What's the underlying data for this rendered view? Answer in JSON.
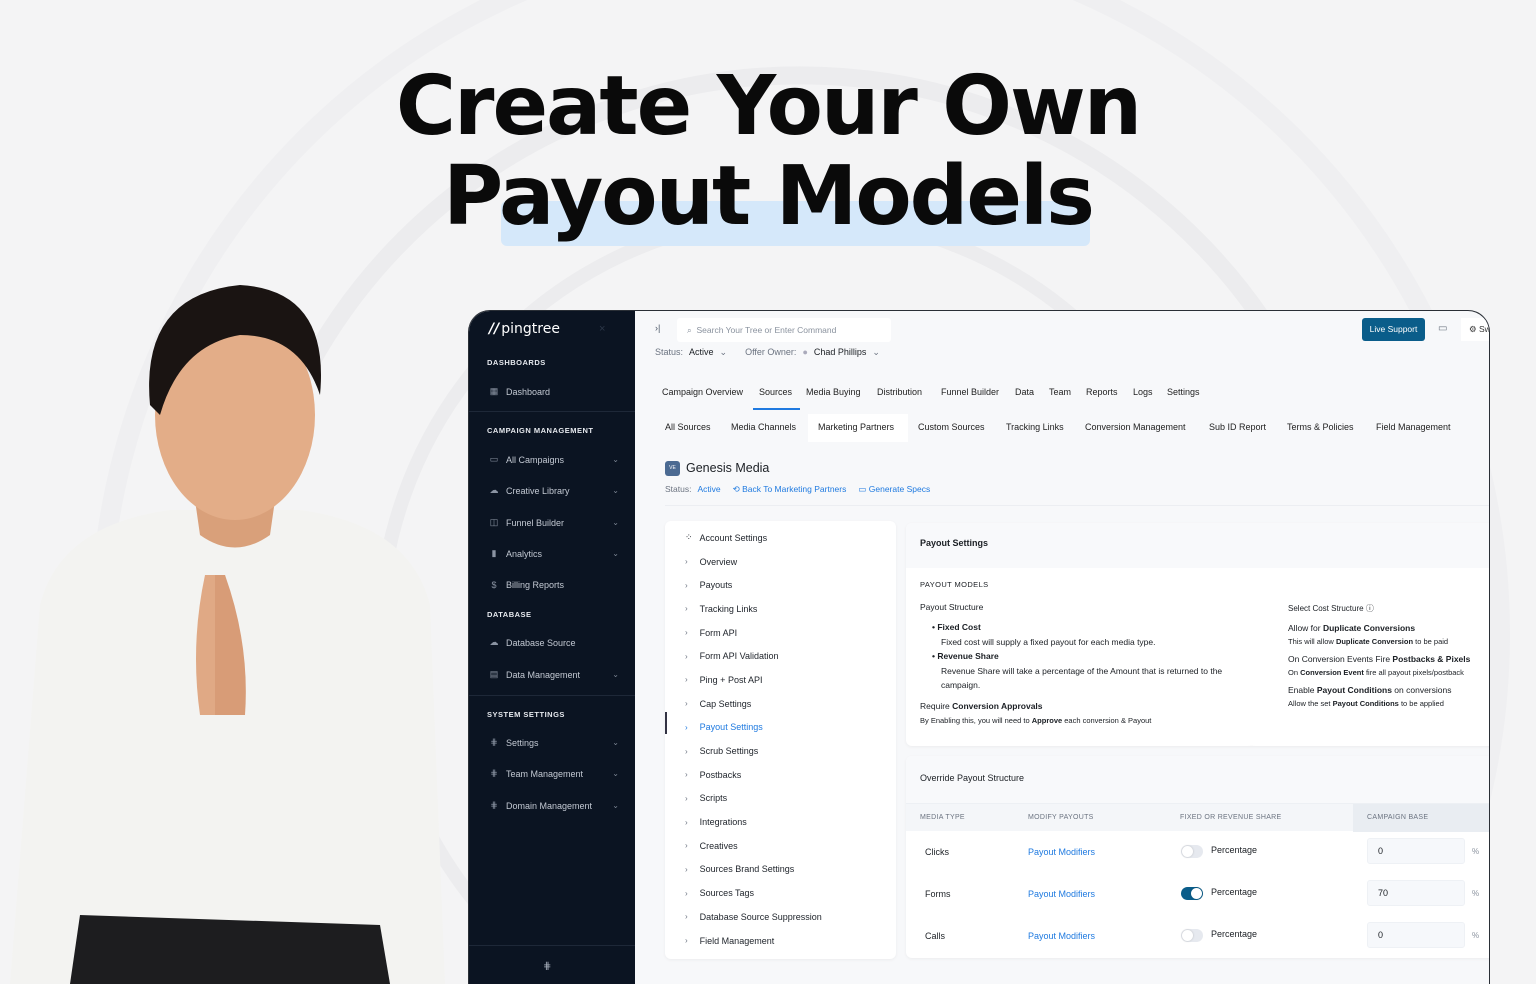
{
  "headline": {
    "line1": "Create Your Own",
    "line2": "Payout Models"
  },
  "colors": {
    "sidebar": "#0b1422",
    "accent": "#0a5d8a",
    "link": "#1f7ae0",
    "highlight": "#d5e8fa"
  },
  "sidebar": {
    "logo": "pingtree",
    "close_icon": "×",
    "sections": [
      {
        "title": "DASHBOARDS"
      },
      {
        "title": "CAMPAIGN MANAGEMENT"
      },
      {
        "title": "DATABASE"
      },
      {
        "title": "SYSTEM SETTINGS"
      }
    ],
    "items": [
      {
        "label": "Dashboard",
        "icon": "grid-icon"
      },
      {
        "label": "All Campaigns",
        "icon": "campaign-icon"
      },
      {
        "label": "Creative Library",
        "icon": "cloud-icon"
      },
      {
        "label": "Funnel Builder",
        "icon": "funnel-icon"
      },
      {
        "label": "Analytics",
        "icon": "bar-chart-icon"
      },
      {
        "label": "Billing Reports",
        "icon": "dollar-icon"
      },
      {
        "label": "Database Source",
        "icon": "cloud-icon"
      },
      {
        "label": "Data Management",
        "icon": "database-icon"
      },
      {
        "label": "Settings",
        "icon": "sliders-icon"
      },
      {
        "label": "Team Management",
        "icon": "sliders-icon"
      },
      {
        "label": "Domain Management",
        "icon": "sliders-icon"
      }
    ]
  },
  "topbar": {
    "search_placeholder": "Search Your Tree or Enter Command",
    "live_support": "Live Support",
    "switch_label": "Sw"
  },
  "statusbar": {
    "status_label": "Status:",
    "status_value": "Active",
    "owner_label": "Offer Owner:",
    "owner_value": "Chad Phillips"
  },
  "tabs": [
    "Campaign Overview",
    "Sources",
    "Media Buying",
    "Distribution",
    "Funnel Builder",
    "Data",
    "Team",
    "Reports",
    "Logs",
    "Settings"
  ],
  "active_tab": "Sources",
  "subtabs": [
    "All Sources",
    "Media Channels",
    "Marketing Partners",
    "Custom Sources",
    "Tracking Links",
    "Conversion Management",
    "Sub ID Report",
    "Terms & Policies",
    "Field Management"
  ],
  "active_subtab": "Marketing Partners",
  "partner": {
    "name": "Genesis Media",
    "badge": "VE",
    "status_label": "Status:",
    "status_value": "Active",
    "back_link": "Back To Marketing Partners",
    "specs_link": "Generate Specs"
  },
  "nav": {
    "header": "Account Settings",
    "items": [
      "Overview",
      "Payouts",
      "Tracking Links",
      "Form API",
      "Form API Validation",
      "Ping + Post API",
      "Cap Settings",
      "Payout Settings",
      "Scrub Settings",
      "Postbacks",
      "Scripts",
      "Integrations",
      "Creatives",
      "Sources Brand Settings",
      "Sources Tags",
      "Database Source Suppression",
      "Field Management"
    ],
    "active": "Payout Settings"
  },
  "payout_settings": {
    "title": "Payout Settings",
    "section": "PAYOUT MODELS",
    "structure_label": "Payout Structure",
    "fixed_title": "Fixed Cost",
    "fixed_desc": "Fixed cost will supply a fixed payout for each media type.",
    "rev_title": "Revenue Share",
    "rev_desc": "Revenue Share will take a percentage of the Amount that is returned to the campaign.",
    "approval_pre": "Require ",
    "approval_bold": "Conversion Approvals",
    "approval_desc_pre": "By Enabling this, you will need to ",
    "approval_desc_bold": "Approve",
    "approval_desc_post": " each conversion & Payout",
    "approval_enabled": false,
    "cost_label": "Select Cost Structure",
    "dup_pre": "Allow for ",
    "dup_bold": "Duplicate Conversions",
    "dup_desc_pre": "This will allow ",
    "dup_desc_bold": "Duplicate Conversion",
    "dup_desc_post": " to be paid",
    "pb_pre": "On Conversion Events Fire ",
    "pb_bold": "Postbacks & Pixels",
    "pb_desc_pre": "On ",
    "pb_desc_bold": "Conversion Event",
    "pb_desc_post": " fire all payout pixels/postback",
    "cond_pre": "Enable ",
    "cond_bold": "Payout Conditions",
    "cond_post": " on conversions",
    "cond_desc_pre": "Allow the set ",
    "cond_desc_bold": "Payout Conditions",
    "cond_desc_post": " to be applied"
  },
  "override": {
    "title": "Override Payout Structure",
    "columns": [
      "MEDIA TYPE",
      "MODIFY PAYOUTS",
      "FIXED OR REVENUE SHARE",
      "CAMPAIGN BASE"
    ],
    "rows": [
      {
        "media": "Clicks",
        "link": "Payout Modifiers",
        "toggle": false,
        "share": "Percentage",
        "base": "0",
        "unit": "%"
      },
      {
        "media": "Forms",
        "link": "Payout Modifiers",
        "toggle": true,
        "share": "Percentage",
        "base": "70",
        "unit": "%"
      },
      {
        "media": "Calls",
        "link": "Payout Modifiers",
        "toggle": false,
        "share": "Percentage",
        "base": "0",
        "unit": "%"
      }
    ]
  }
}
